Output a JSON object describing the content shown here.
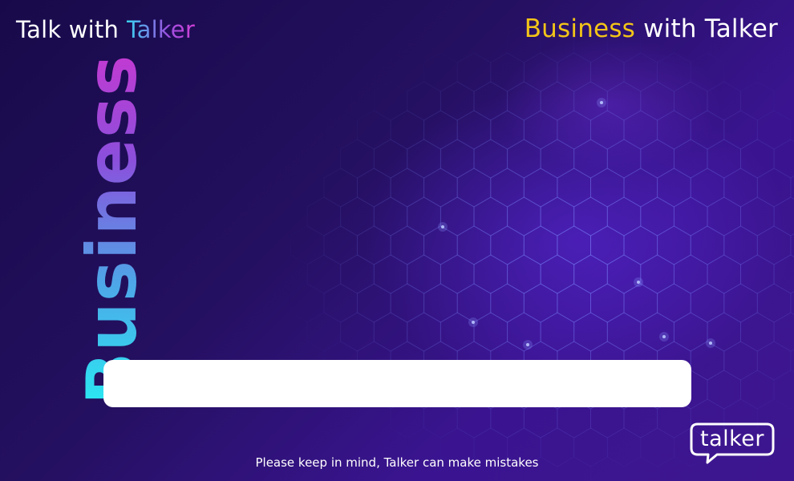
{
  "header": {
    "left_prefix": "Talk with ",
    "left_accent": "Talker",
    "right_accent": "Business",
    "right_suffix": " with Talker"
  },
  "sidebar": {
    "vertical_title": "Business"
  },
  "chat": {
    "input_value": "",
    "input_placeholder": ""
  },
  "footer": {
    "disclaimer": "Please keep in mind, Talker can make mistakes"
  },
  "logo": {
    "text": "talker"
  },
  "colors": {
    "background": "#241060",
    "accent_yellow": "#f2c418",
    "accent_cyan": "#2ae8f2",
    "accent_magenta": "#c23ad2",
    "input_background": "#ffffff"
  },
  "icons": {
    "logo": "talker-speech-bubble-logo"
  }
}
